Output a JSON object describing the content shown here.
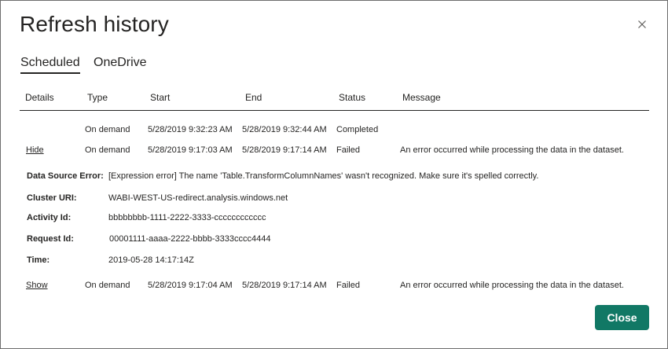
{
  "dialog": {
    "title": "Refresh history",
    "close_icon": "close-icon",
    "close_button": "Close",
    "accent_color": "#117865"
  },
  "tabs": [
    {
      "label": "Scheduled",
      "active": true
    },
    {
      "label": "OneDrive",
      "active": false
    }
  ],
  "columns": [
    "Details",
    "Type",
    "Start",
    "End",
    "Status",
    "Message"
  ],
  "rows": [
    {
      "details": "",
      "type": "On demand",
      "start": "5/28/2019 9:32:23 AM",
      "end": "5/28/2019 9:32:44 AM",
      "status": "Completed",
      "message": ""
    },
    {
      "details": "Hide",
      "type": "On demand",
      "start": "5/28/2019 9:17:03 AM",
      "end": "5/28/2019 9:17:14 AM",
      "status": "Failed",
      "message": "An error occurred while processing the data in the dataset."
    },
    {
      "details": "Show",
      "type": "On demand",
      "start": "5/28/2019 9:17:04 AM",
      "end": "5/28/2019 9:17:14 AM",
      "status": "Failed",
      "message": "An error occurred while processing the data in the dataset."
    }
  ],
  "error_details": [
    {
      "label": "Data Source Error:",
      "value": "[Expression error] The name 'Table.TransformColumnNames' wasn't recognized. Make sure it's spelled correctly."
    },
    {
      "label": "Cluster URI:",
      "value": "WABI-WEST-US-redirect.analysis.windows.net"
    },
    {
      "label": "Activity Id:",
      "value": "bbbbbbbb-1111-2222-3333-cccccccccccc"
    },
    {
      "label": "Request Id:",
      "value": "00001111-aaaa-2222-bbbb-3333cccc4444"
    },
    {
      "label": "Time:",
      "value": "2019-05-28 14:17:14Z"
    }
  ]
}
